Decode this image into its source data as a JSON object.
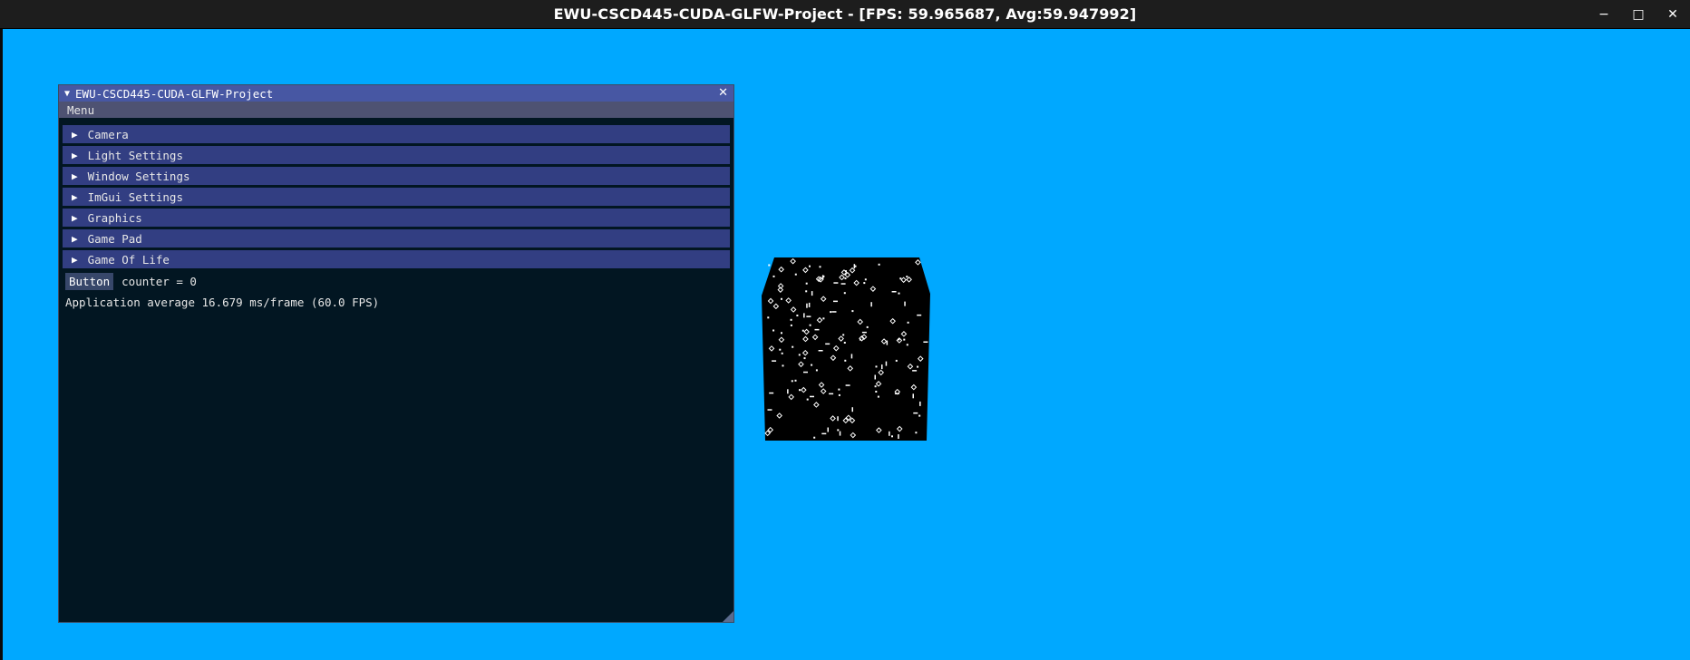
{
  "os_window": {
    "title": "EWU-CSCD445-CUDA-GLFW-Project - [FPS: 59.965687, Avg:59.947992]",
    "controls": {
      "minimize": "−",
      "maximize": "□",
      "close": "✕"
    }
  },
  "imgui_window": {
    "title": "EWU-CSCD445-CUDA-GLFW-Project",
    "collapse_glyph": "▼",
    "close_glyph": "✕",
    "menu": "Menu",
    "headers": [
      {
        "label": "Camera"
      },
      {
        "label": "Light Settings"
      },
      {
        "label": "Window Settings"
      },
      {
        "label": "ImGui Settings"
      },
      {
        "label": "Graphics"
      },
      {
        "label": "Game Pad"
      },
      {
        "label": "Game Of Life"
      }
    ],
    "header_glyph": "▶",
    "button_label": "Button",
    "counter_text": "counter = 0",
    "perf_text": "Application average 16.679 ms/frame (60.0 FPS)"
  },
  "colors": {
    "background": "#00a8ff",
    "window_bg": "#021622",
    "title_bar": "#4757a3",
    "menu_bar": "#4e5272",
    "header": "#323e82",
    "cube": "#000000"
  },
  "icons": {
    "collapse": "triangle-down-icon",
    "header": "triangle-right-icon",
    "close": "close-icon"
  }
}
